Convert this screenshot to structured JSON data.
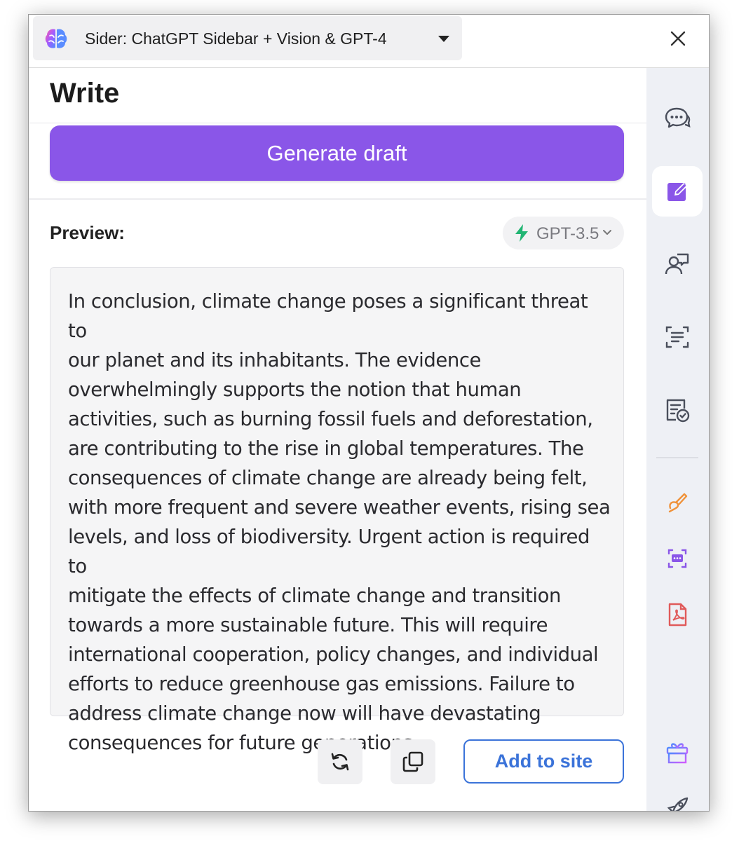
{
  "window": {
    "extension_title": "Sider: ChatGPT Sidebar + Vision & GPT-4",
    "close_icon": "close-icon"
  },
  "panel": {
    "title": "Write",
    "generate_button": "Generate draft",
    "preview_label": "Preview:",
    "model": "GPT-3.5",
    "preview_text": "In conclusion, climate change poses a significant threat to\nour planet and its inhabitants. The evidence\noverwhelmingly supports the notion that human\nactivities, such as burning fossil fuels and deforestation,\nare contributing to the rise in global temperatures. The\nconsequences of climate change are already being felt,\nwith more frequent and severe weather events, rising sea\nlevels, and loss of biodiversity. Urgent action is required to\nmitigate the effects of climate change and transition\ntowards a more sustainable future. This will require\ninternational cooperation, policy changes, and individual\nefforts to reduce greenhouse gas emissions. Failure to\naddress climate change now will have devastating\nconsequences for future generations.",
    "actions": {
      "regenerate_icon": "refresh-icon",
      "copy_icon": "copy-icon",
      "add_button": "Add to site"
    }
  },
  "rail": {
    "items": [
      "chat-icon",
      "write-icon",
      "user-chat-icon",
      "scan-text-icon",
      "checklist-icon",
      "brush-icon",
      "bracket-chat-icon",
      "pdf-icon",
      "gift-icon",
      "rocket-icon"
    ],
    "active": "write-icon"
  },
  "colors": {
    "accent_purple": "#8a56e8",
    "link_blue": "#3b73d9",
    "bolt_green": "#22b573",
    "rail_bg": "#eef0f5"
  }
}
